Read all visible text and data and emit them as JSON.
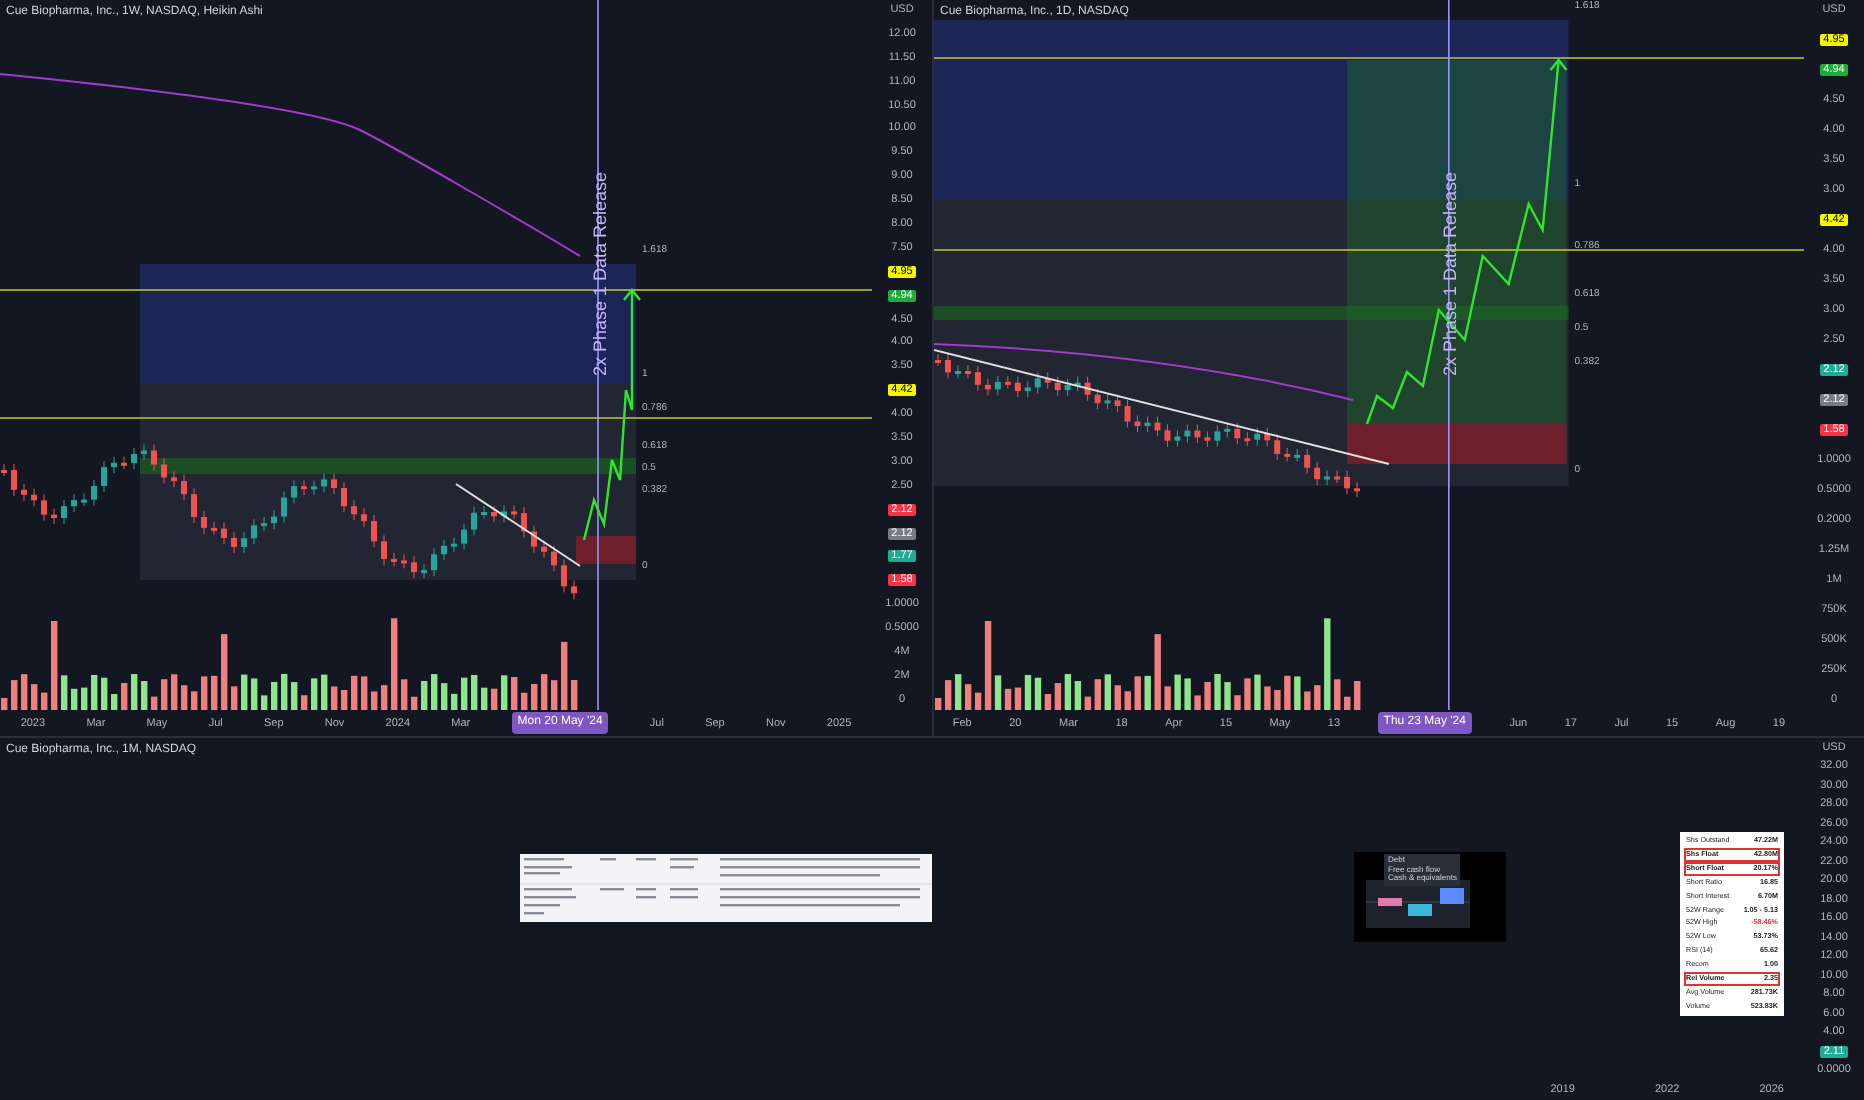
{
  "panes": [
    {
      "title": "Cue Biopharma, Inc., 1W, NASDAQ, Heikin Ashi",
      "annotation": "2x Phase 1 Data Release",
      "fib_levels": [
        "1.618",
        "1",
        "0.786",
        "0.618",
        "0.5",
        "0.382",
        "0"
      ],
      "axis": [
        {
          "kind": "label",
          "text": "USD"
        },
        {
          "kind": "label",
          "text": "12.00"
        },
        {
          "kind": "label",
          "text": "11.50"
        },
        {
          "kind": "label",
          "text": "11.00"
        },
        {
          "kind": "label",
          "text": "10.50"
        },
        {
          "kind": "label",
          "text": "10.00"
        },
        {
          "kind": "label",
          "text": "9.50"
        },
        {
          "kind": "label",
          "text": "9.00"
        },
        {
          "kind": "label",
          "text": "8.50"
        },
        {
          "kind": "label",
          "text": "8.00"
        },
        {
          "kind": "label",
          "text": "7.50"
        },
        {
          "kind": "badge",
          "text": "4.95",
          "color": "#f5f500"
        },
        {
          "kind": "badge",
          "text": "4.94",
          "color": "#22ab3a"
        },
        {
          "kind": "label",
          "text": "4.50"
        },
        {
          "kind": "label",
          "text": "4.00"
        },
        {
          "kind": "label",
          "text": "3.50"
        },
        {
          "kind": "badge",
          "text": "4.42",
          "color": "#f5f500"
        },
        {
          "kind": "label",
          "text": "4.00"
        },
        {
          "kind": "label",
          "text": "3.50"
        },
        {
          "kind": "label",
          "text": "3.00"
        },
        {
          "kind": "label",
          "text": "2.50"
        },
        {
          "kind": "badge",
          "text": "2.12",
          "color": "#f23645"
        },
        {
          "kind": "badge",
          "text": "2.12",
          "color": "#787b86"
        },
        {
          "kind": "badge",
          "text": "1.77",
          "color": "#22ab94"
        },
        {
          "kind": "badge",
          "text": "1.58",
          "color": "#f23645"
        },
        {
          "kind": "label",
          "text": "1.0000"
        },
        {
          "kind": "label",
          "text": "0.5000"
        },
        {
          "kind": "label",
          "text": "4M"
        },
        {
          "kind": "label",
          "text": "2M"
        },
        {
          "kind": "label",
          "text": "0"
        }
      ],
      "time": [
        {
          "kind": "date",
          "text": "2023"
        },
        {
          "kind": "date",
          "text": "Mar"
        },
        {
          "kind": "date",
          "text": "May"
        },
        {
          "kind": "date",
          "text": "Jul"
        },
        {
          "kind": "date",
          "text": "Sep"
        },
        {
          "kind": "date",
          "text": "Nov"
        },
        {
          "kind": "date",
          "text": "2024"
        },
        {
          "kind": "date",
          "text": "Mar"
        },
        {
          "kind": "cursor",
          "text": "Mon 20 May '24"
        },
        {
          "kind": "date",
          "text": "Jul"
        },
        {
          "kind": "date",
          "text": "Sep"
        },
        {
          "kind": "date",
          "text": "Nov"
        },
        {
          "kind": "date",
          "text": "2025"
        }
      ]
    },
    {
      "title": "Cue Biopharma, Inc., 1D, NASDAQ",
      "annotation": "2x Phase 1 Data Release",
      "fib_levels": [
        "1.618",
        "1",
        "0.786",
        "0.618",
        "0.5",
        "0.382",
        "0"
      ],
      "axis": [
        {
          "kind": "label",
          "text": "USD"
        },
        {
          "kind": "badge",
          "text": "4.95",
          "color": "#f5f500"
        },
        {
          "kind": "badge",
          "text": "4.94",
          "color": "#22ab3a"
        },
        {
          "kind": "label",
          "text": "4.50"
        },
        {
          "kind": "label",
          "text": "4.00"
        },
        {
          "kind": "label",
          "text": "3.50"
        },
        {
          "kind": "label",
          "text": "3.00"
        },
        {
          "kind": "badge",
          "text": "4.42",
          "color": "#f5f500"
        },
        {
          "kind": "label",
          "text": "4.00"
        },
        {
          "kind": "label",
          "text": "3.50"
        },
        {
          "kind": "label",
          "text": "3.00"
        },
        {
          "kind": "label",
          "text": "2.50"
        },
        {
          "kind": "badge",
          "text": "2.12",
          "color": "#22ab94"
        },
        {
          "kind": "badge",
          "text": "2.12",
          "color": "#787b86"
        },
        {
          "kind": "badge",
          "text": "1.58",
          "color": "#f23645"
        },
        {
          "kind": "label",
          "text": "1.0000"
        },
        {
          "kind": "label",
          "text": "0.5000"
        },
        {
          "kind": "label",
          "text": "0.2000"
        },
        {
          "kind": "label",
          "text": "1.25M"
        },
        {
          "kind": "label",
          "text": "1M"
        },
        {
          "kind": "label",
          "text": "750K"
        },
        {
          "kind": "label",
          "text": "500K"
        },
        {
          "kind": "label",
          "text": "250K"
        },
        {
          "kind": "label",
          "text": "0"
        }
      ],
      "time": [
        {
          "kind": "date",
          "text": "Feb"
        },
        {
          "kind": "date",
          "text": "20"
        },
        {
          "kind": "date",
          "text": "Mar"
        },
        {
          "kind": "date",
          "text": "18"
        },
        {
          "kind": "date",
          "text": "Apr"
        },
        {
          "kind": "date",
          "text": "15"
        },
        {
          "kind": "date",
          "text": "May"
        },
        {
          "kind": "date",
          "text": "13"
        },
        {
          "kind": "cursor",
          "text": "Thu 23 May '24"
        },
        {
          "kind": "date",
          "text": "Jun"
        },
        {
          "kind": "date",
          "text": "17"
        },
        {
          "kind": "date",
          "text": "Jul"
        },
        {
          "kind": "date",
          "text": "15"
        },
        {
          "kind": "date",
          "text": "Aug"
        },
        {
          "kind": "date",
          "text": "19"
        }
      ]
    }
  ],
  "bottom": {
    "title": "Cue Biopharma, Inc., 1M, NASDAQ",
    "legend": [
      "Debt",
      "Free cash flow",
      "Cash & equivalents"
    ],
    "stats": [
      {
        "label": "Shs Outstand",
        "value": "47.22M",
        "boxed": false,
        "negative": false
      },
      {
        "label": "Shs Float",
        "value": "42.80M",
        "boxed": true,
        "negative": false
      },
      {
        "label": "Short Float",
        "value": "20.17%",
        "boxed": true,
        "negative": false
      },
      {
        "label": "Short Ratio",
        "value": "16.85",
        "boxed": false,
        "negative": false
      },
      {
        "label": "Short Interest",
        "value": "6.70M",
        "boxed": false,
        "negative": false
      },
      {
        "label": "52W Range",
        "value": "1.05 - 5.13",
        "boxed": false,
        "negative": false
      },
      {
        "label": "52W High",
        "value": "-58.46%",
        "boxed": false,
        "negative": true
      },
      {
        "label": "52W Low",
        "value": "53.73%",
        "boxed": false,
        "negative": false
      },
      {
        "label": "RSI (14)",
        "value": "65.62",
        "boxed": false,
        "negative": false
      },
      {
        "label": "Recom",
        "value": "1.00",
        "boxed": false,
        "negative": false
      },
      {
        "label": "Rel Volume",
        "value": "2.35",
        "boxed": true,
        "negative": false
      },
      {
        "label": "Avg Volume",
        "value": "281.73K",
        "boxed": false,
        "negative": false
      },
      {
        "label": "Volume",
        "value": "523.83K",
        "boxed": false,
        "negative": false
      }
    ],
    "axis": [
      {
        "kind": "label",
        "text": "USD"
      },
      {
        "kind": "label",
        "text": "32.00"
      },
      {
        "kind": "label",
        "text": "30.00"
      },
      {
        "kind": "label",
        "text": "28.00"
      },
      {
        "kind": "label",
        "text": "26.00"
      },
      {
        "kind": "label",
        "text": "24.00"
      },
      {
        "kind": "label",
        "text": "22.00"
      },
      {
        "kind": "label",
        "text": "20.00"
      },
      {
        "kind": "label",
        "text": "18.00"
      },
      {
        "kind": "label",
        "text": "16.00"
      },
      {
        "kind": "label",
        "text": "14.00"
      },
      {
        "kind": "label",
        "text": "12.00"
      },
      {
        "kind": "label",
        "text": "10.00"
      },
      {
        "kind": "label",
        "text": "8.00"
      },
      {
        "kind": "label",
        "text": "6.00"
      },
      {
        "kind": "label",
        "text": "4.00"
      },
      {
        "kind": "badge",
        "text": "2.11",
        "color": "#22ab94"
      },
      {
        "kind": "label",
        "text": "0.0000"
      }
    ],
    "time": [
      {
        "kind": "date",
        "text": "2019"
      },
      {
        "kind": "date",
        "text": "2022"
      },
      {
        "kind": "date",
        "text": "2026"
      }
    ]
  }
}
